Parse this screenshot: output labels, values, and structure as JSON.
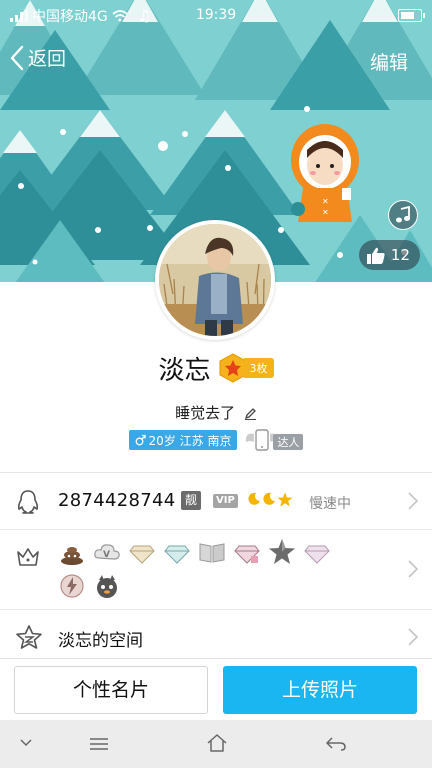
{
  "status_bar": {
    "carrier": "中国移动4G",
    "time": "19:39"
  },
  "nav": {
    "back_label": "返回",
    "edit_label": "编辑"
  },
  "banner": {
    "like_count": "12"
  },
  "profile": {
    "nickname": "淡忘",
    "level_badge_count": "3枚",
    "signature": "睡觉去了",
    "age_location": "20岁 江苏 南京",
    "talent_label": "达人"
  },
  "info": {
    "qq_number": "2874428744",
    "liang_label": "靓",
    "vip_label": "VIP",
    "speed_status": "慢速中",
    "space_label": "淡忘的空间"
  },
  "actions": {
    "card_label": "个性名片",
    "upload_label": "上传照片"
  },
  "colors": {
    "accent": "#1ab6f2",
    "banner_bg": "#7fcfd0",
    "age_tag": "#3aa8e6",
    "level_gold": "#f5b21a"
  }
}
